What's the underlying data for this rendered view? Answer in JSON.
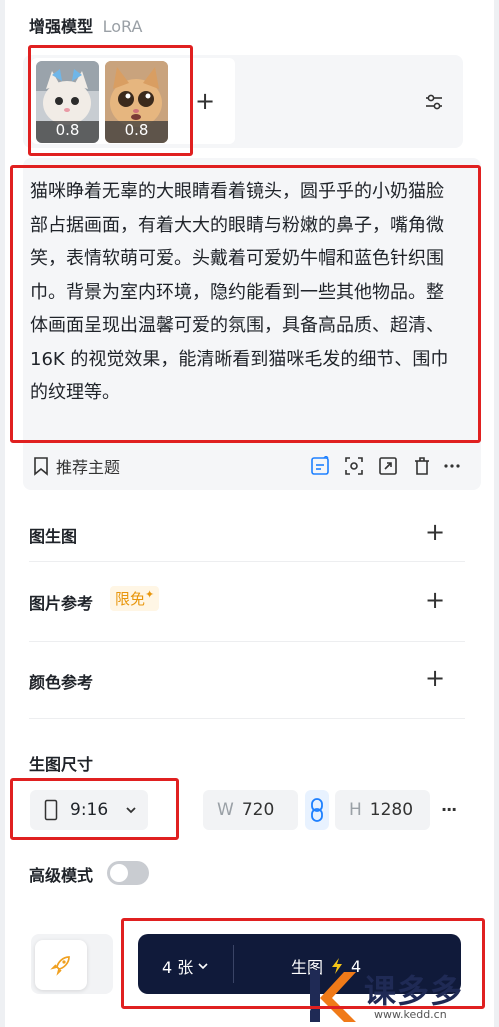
{
  "lora": {
    "title": "增强模型",
    "subtitle": "LoRA",
    "thumbs": [
      {
        "weight": "0.8"
      },
      {
        "weight": "0.8"
      }
    ],
    "add_label": "+"
  },
  "prompt": {
    "text": "猫咪睁着无辜的大眼睛看着镜头，圆乎乎的小奶猫脸部占据画面，有着大大的眼睛与粉嫩的鼻子，嘴角微笑，表情软萌可爱。头戴着可爱奶牛帽和蓝色针织围巾。背景为室内环境，隐约能看到一些其他物品。整体画面呈现出温馨可爱的氛围，具备高品质、超清、16K 的视觉效果，能清晰看到猫咪毛发的细节、围巾的纹理等。",
    "recommend_label": "推荐主题"
  },
  "sections": {
    "img2img": "图生图",
    "image_ref": "图片参考",
    "image_ref_badge": "限免",
    "color_ref": "颜色参考",
    "plus": "+"
  },
  "size": {
    "title": "生图尺寸",
    "ratio": "9:16",
    "w_label": "W",
    "w_value": "720",
    "h_label": "H",
    "h_value": "1280",
    "more": "···"
  },
  "advanced": {
    "label": "高级模式",
    "enabled": false
  },
  "generate": {
    "count": "4 张",
    "label": "生图",
    "cost": "4"
  },
  "watermark": {
    "brand": "课多多",
    "url": "www.kedd.cn"
  },
  "colors": {
    "accent_blue": "#1e80ff",
    "red_box": "#e02020",
    "gen_button": "#101a3a",
    "badge": "#f5a623"
  }
}
